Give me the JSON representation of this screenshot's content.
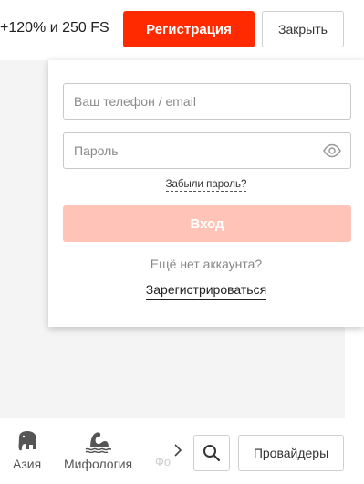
{
  "header": {
    "promo_text": "+120% и 250 FS",
    "register_label": "Регистрация",
    "close_label": "Закрыть"
  },
  "login_form": {
    "login_placeholder": "Ваш телефон / email",
    "password_placeholder": "Пароль",
    "forgot_label": "Забыли пароль?",
    "submit_label": "Вход",
    "no_account_text": "Ещё нет аккаунта?",
    "signup_label": "Зарегистрироваться"
  },
  "categories": {
    "items": [
      {
        "label": "Азия",
        "icon": "elephant-icon"
      },
      {
        "label": "Мифология",
        "icon": "sea-monster-icon"
      }
    ],
    "faded_label": "Фо"
  },
  "toolbar": {
    "providers_label": "Провайдеры"
  },
  "colors": {
    "accent": "#ff2a00",
    "accent_disabled": "#ffc4b7",
    "background": "#f4f4f4"
  }
}
